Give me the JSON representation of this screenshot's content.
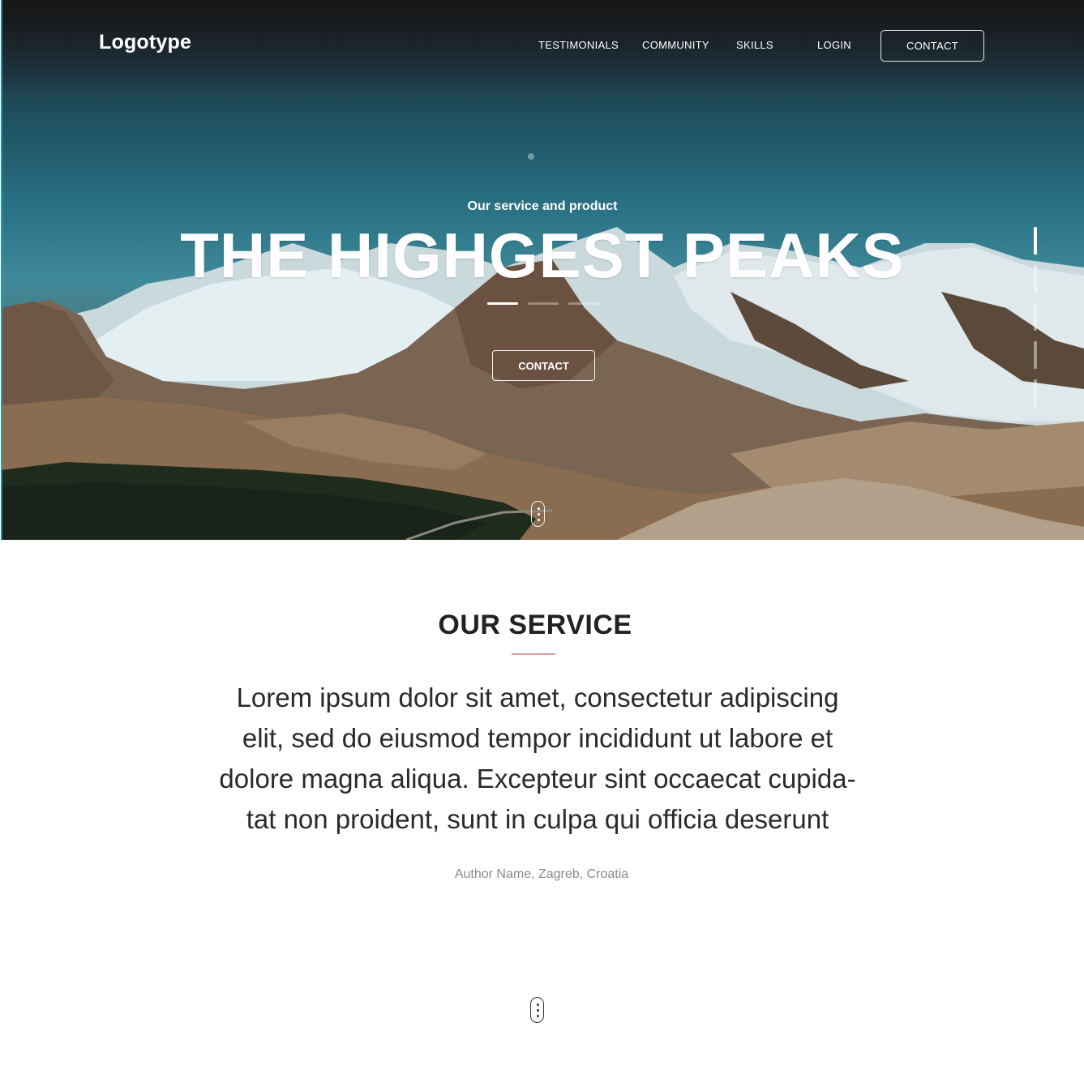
{
  "header": {
    "logo": "Logotype",
    "nav": [
      "TESTIMONIALS",
      "COMMUNITY",
      "SKILLS",
      "LOGIN"
    ],
    "contact_button": "CONTACT"
  },
  "hero": {
    "kicker": "Our service and product",
    "title": "THE HIGHGEST PEAKS",
    "cta": "CONTACT",
    "slides": {
      "count": 3,
      "active": 0
    },
    "side_pager": {
      "count": 5,
      "active": 0
    },
    "icons": {
      "scroll": "mouse-scroll-icon"
    }
  },
  "service": {
    "title": "OUR SERVICE",
    "text_lines": [
      "Lorem ipsum dolor sit amet, consectetur adipiscing",
      "elit, sed do eiusmod tempor incididunt ut labore et",
      "dolore magna aliqua. Excepteur sint occaecat cupida-",
      "tat non proident, sunt in culpa qui officia deserunt"
    ],
    "author": "Author Name, Zagreb, Croatia",
    "icons": {
      "scroll": "mouse-scroll-icon"
    }
  },
  "colors": {
    "accent_rule": "#e39a9e",
    "hero_text": "#ffffff",
    "heading": "#222222",
    "author": "#8a8a8a"
  }
}
